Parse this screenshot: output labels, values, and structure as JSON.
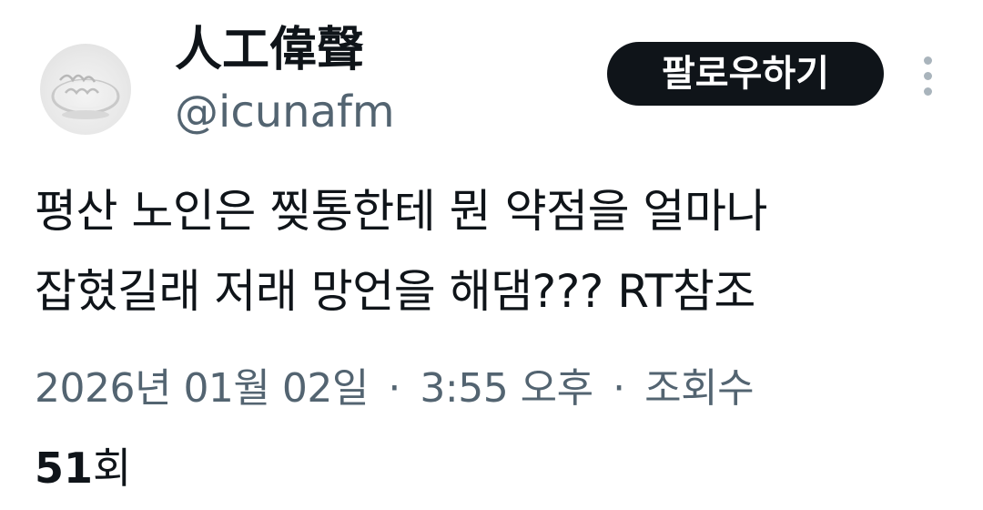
{
  "author": {
    "display_name": "人工偉聲",
    "handle": "@icunafm",
    "avatar_icon": "ring-photo-avatar"
  },
  "actions": {
    "follow_label": "팔로우하기",
    "more_icon": "more-vertical-icon"
  },
  "tweet": {
    "lines": [
      "평산 노인은 찢통한테 뭔 약점을 얼마나",
      "잡혔길래 저래 망언을 해댐??? RT참조"
    ]
  },
  "meta": {
    "date": "2026년 01월 02일",
    "separator": "·",
    "time": "3:55 오후",
    "views_label": "조회수",
    "views_count": "51",
    "views_unit": "회"
  },
  "colors": {
    "text_primary": "#0f1419",
    "text_secondary": "#536471",
    "button_bg": "#0f1419",
    "button_text": "#ffffff",
    "dots": "#a9b4bc"
  }
}
